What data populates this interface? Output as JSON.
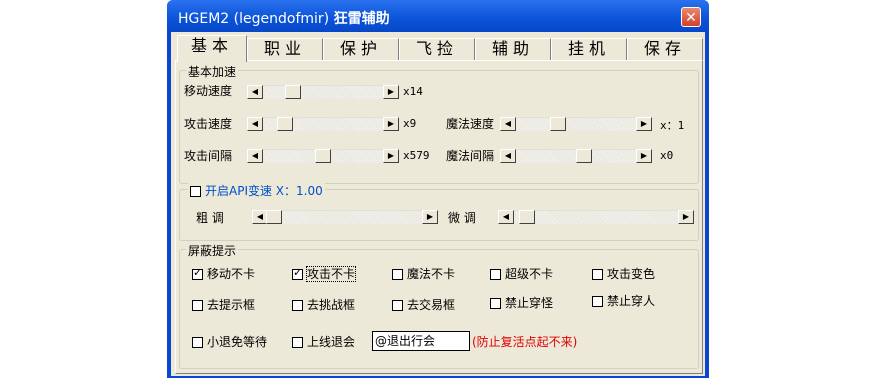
{
  "window": {
    "title_prefix": "HGEM2 (legendofmir)",
    "title_bold": "狂雷辅助",
    "close": "✕"
  },
  "tabs": [
    {
      "label": "基本",
      "active": true
    },
    {
      "label": "职业"
    },
    {
      "label": "保护"
    },
    {
      "label": "飞捡"
    },
    {
      "label": "辅助"
    },
    {
      "label": "挂机"
    },
    {
      "label": "保存"
    }
  ],
  "speed_group": {
    "legend": "基本加速",
    "move": {
      "label": "移动速度",
      "value": "x14",
      "level": 0.2
    },
    "attack": {
      "label": "攻击速度",
      "value": "x9",
      "level": 0.15
    },
    "attack_interval": {
      "label": "攻击间隔",
      "value": "x579",
      "level": 0.5
    },
    "magic": {
      "label": "魔法速度",
      "value": "x：1",
      "level": 0.3
    },
    "magic_interval": {
      "label": "魔法间隔",
      "value": "x0",
      "level": 0.5
    }
  },
  "api_group": {
    "legend": "开启API变速 X：1.00",
    "checked": false,
    "coarse_label": "粗  调",
    "coarse_level": 0.05,
    "fine_label": "微  调",
    "fine_level": 0.15
  },
  "prompt_group": {
    "legend": "屏蔽提示",
    "checks": [
      {
        "label": "移动不卡",
        "checked": true
      },
      {
        "label": "攻击不卡",
        "checked": true
      },
      {
        "label": "魔法不卡",
        "checked": false
      },
      {
        "label": "超级不卡",
        "checked": false
      },
      {
        "label": "攻击变色",
        "checked": false
      },
      {
        "label": "去提示框",
        "checked": false
      },
      {
        "label": "去挑战框",
        "checked": false
      },
      {
        "label": "去交易框",
        "checked": false
      },
      {
        "label": "禁止穿怪",
        "checked": false
      },
      {
        "label": "禁止穿人",
        "checked": false
      },
      {
        "label": "小退免等待",
        "checked": false
      },
      {
        "label": "上线退会",
        "checked": false
      }
    ],
    "input_value": "@退出行会",
    "note": "(防止复活点起不来)"
  }
}
